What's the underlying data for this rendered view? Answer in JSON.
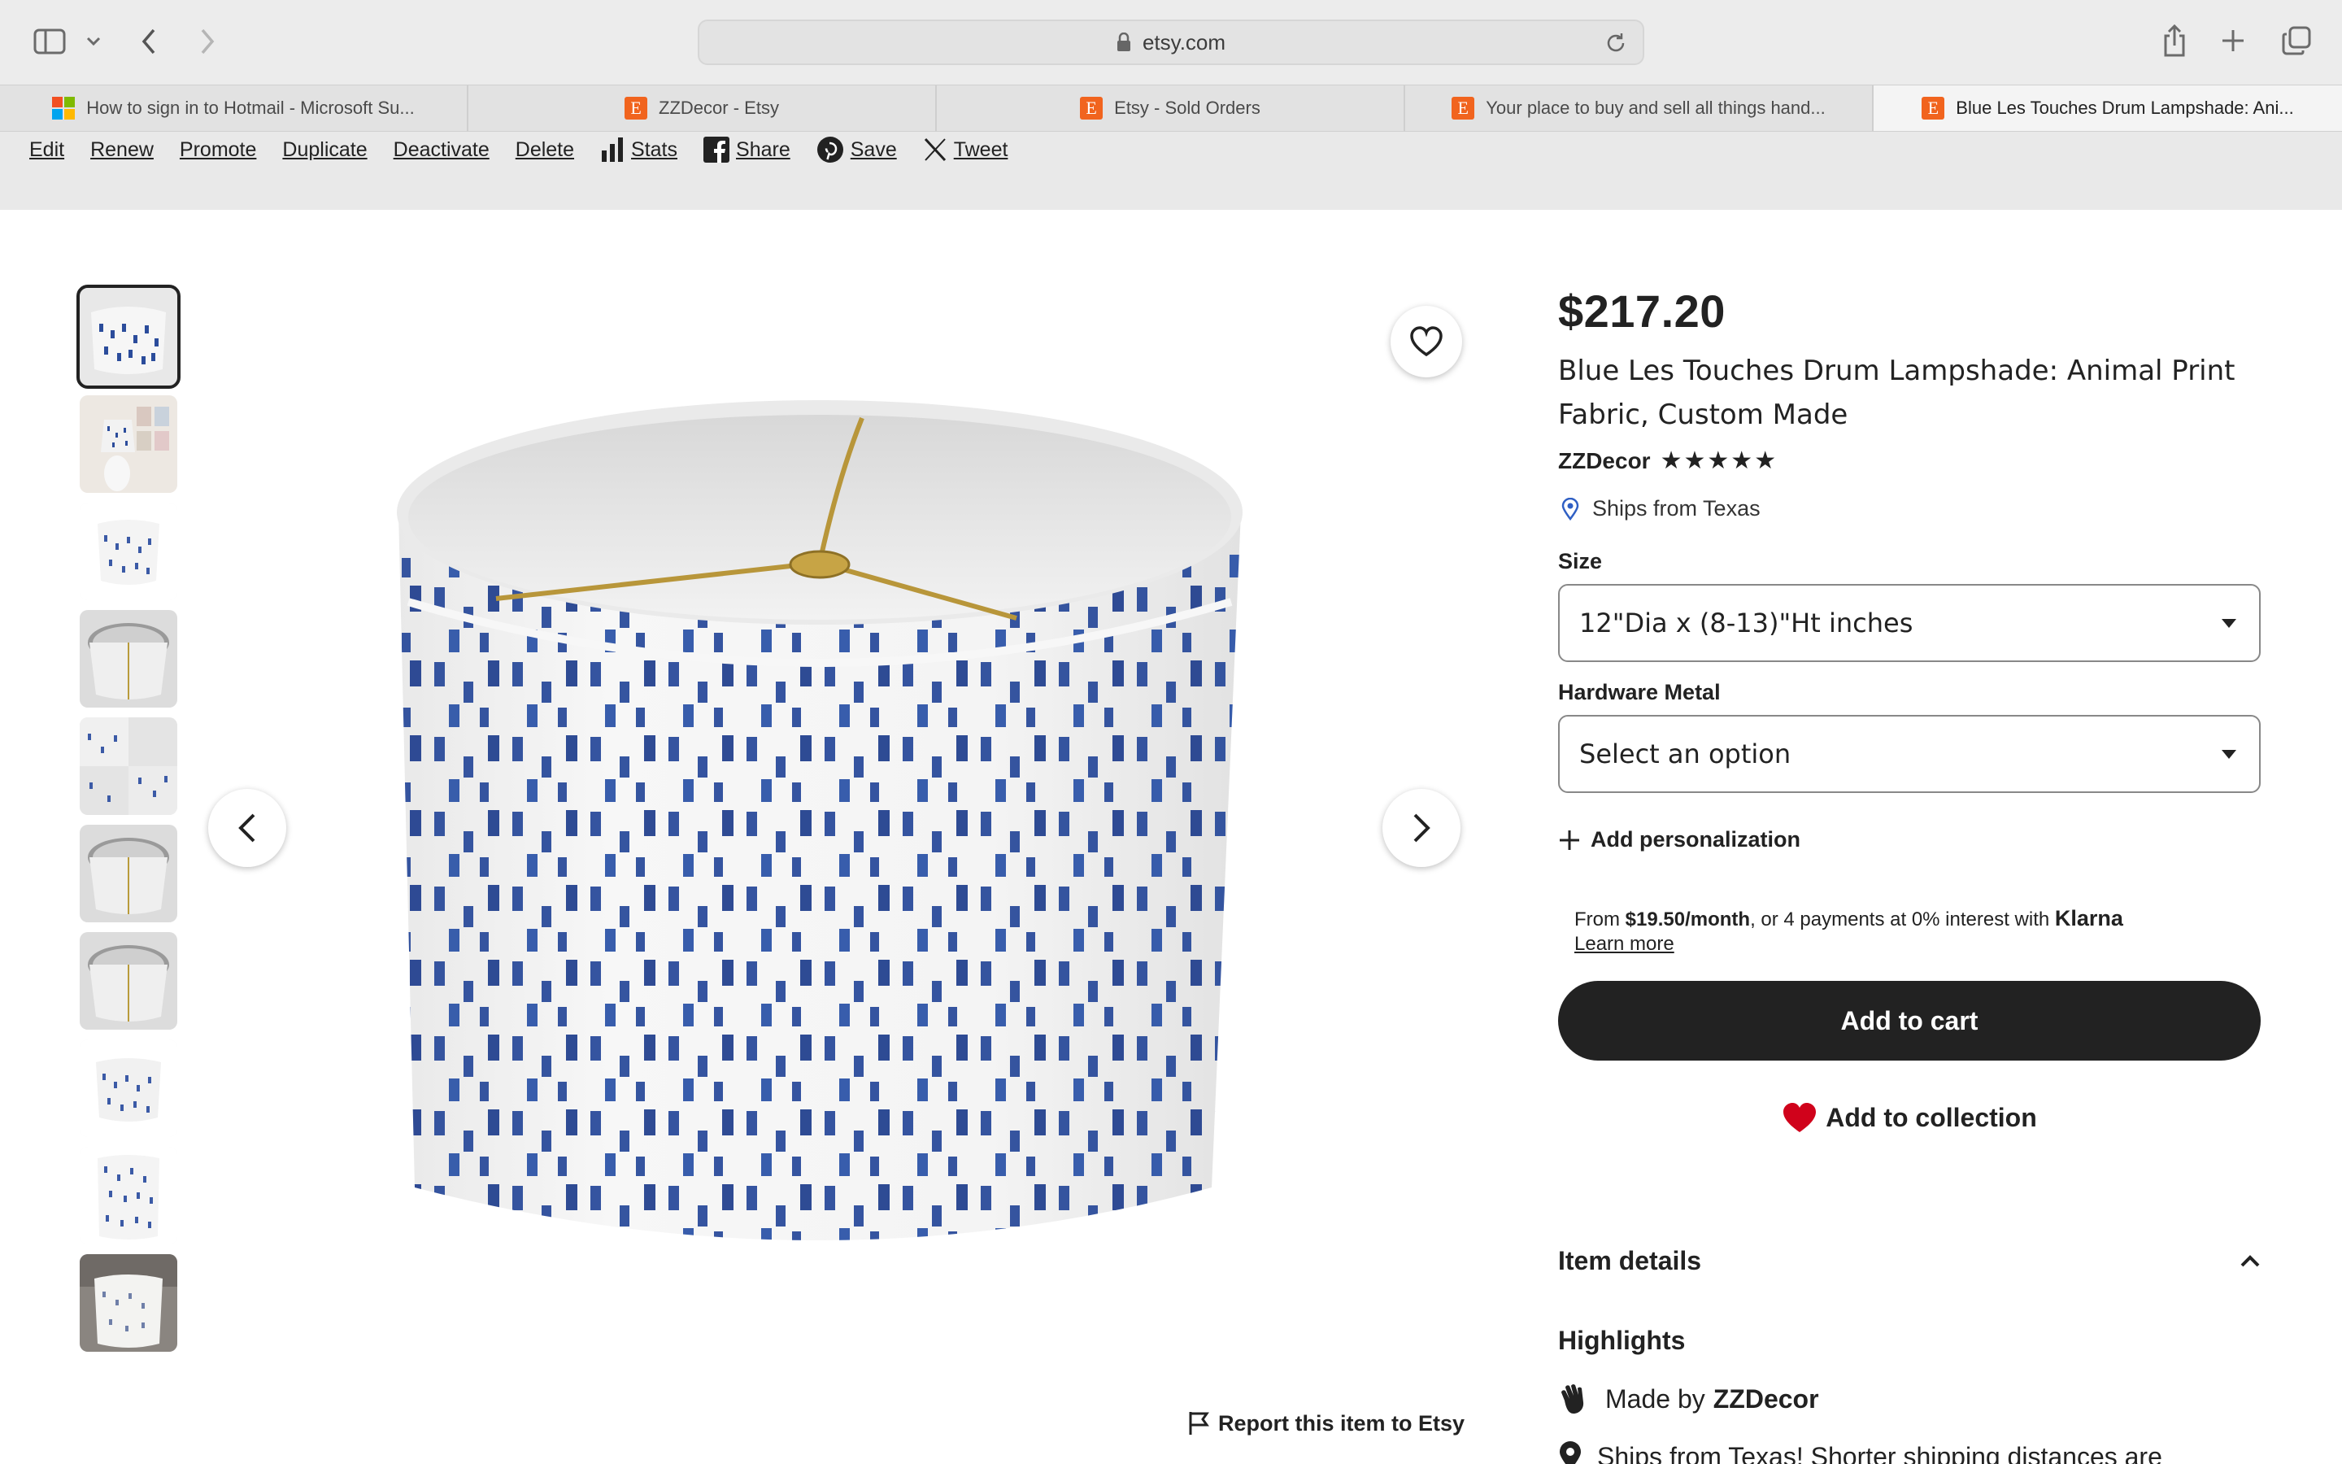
{
  "browser": {
    "url": "etsy.com",
    "tabs": [
      {
        "label": "How to sign in to Hotmail - Microsoft Su...",
        "favicon": "microsoft-icon",
        "active": false
      },
      {
        "label": "ZZDecor - Etsy",
        "favicon": "etsy-icon",
        "active": false
      },
      {
        "label": "Etsy - Sold Orders",
        "favicon": "etsy-icon",
        "active": false
      },
      {
        "label": "Your place to buy and sell all things hand...",
        "favicon": "etsy-icon",
        "active": false
      },
      {
        "label": "Blue Les Touches Drum Lampshade: Ani...",
        "favicon": "etsy-icon",
        "active": true
      }
    ]
  },
  "owner_actions": {
    "edit": "Edit",
    "renew": "Renew",
    "promote": "Promote",
    "duplicate": "Duplicate",
    "deactivate": "Deactivate",
    "delete": "Delete",
    "stats": "Stats",
    "share": "Share",
    "save": "Save",
    "tweet": "Tweet"
  },
  "gallery": {
    "thumbnail_count": 10,
    "selected_index": 0,
    "report_label": "Report this item to Etsy"
  },
  "listing": {
    "price": "$217.20",
    "title": "Blue Les Touches Drum Lampshade: Animal Print Fabric, Custom Made",
    "shop_name": "ZZDecor",
    "rating_stars": 5,
    "ships_from": "Ships from Texas",
    "size_label": "Size",
    "size_value": "12\"Dia x (8-13)\"Ht inches",
    "hardware_label": "Hardware Metal",
    "hardware_value": "Select an option",
    "add_personalization": "Add personalization",
    "klarna": {
      "prefix": "From ",
      "amount": "$19.50/month",
      "middle": ", or 4 payments at 0% interest with ",
      "brand": "Klarna",
      "link": "Learn more"
    },
    "add_to_cart": "Add to cart",
    "add_to_collection": "Add to collection",
    "item_details": "Item details",
    "highlights": "Highlights",
    "made_by_prefix": "Made by",
    "made_by_shop": "ZZDecor",
    "ships_note": "Ships from Texas! Shorter shipping distances are"
  },
  "colors": {
    "accent_dark": "#222222",
    "heart_red": "#d0021b",
    "etsy_orange": "#f1641e",
    "location_blue": "#2f5fc4",
    "pattern_blue": "#2b4c9b"
  }
}
